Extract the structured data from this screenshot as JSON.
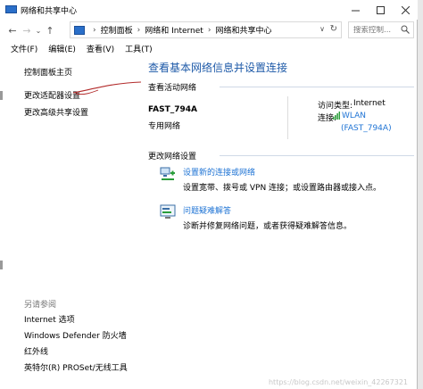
{
  "window": {
    "title": "网络和共享中心"
  },
  "nav": {
    "back_arrow": "←",
    "forward_arrow": "→",
    "recent_arrow": "⌄",
    "up_arrow": "↑",
    "breadcrumb": [
      "控制面板",
      "网络和 Internet",
      "网络和共享中心"
    ],
    "breadcrumb_sep": "›",
    "search_placeholder": "搜索控制..."
  },
  "menu": [
    "文件(F)",
    "编辑(E)",
    "查看(V)",
    "工具(T)"
  ],
  "sidebar": {
    "links": [
      "控制面板主页",
      "更改适配器设置",
      "更改高级共享设置"
    ],
    "see_also_title": "另请参阅",
    "see_also": [
      "Internet 选项",
      "Windows Defender 防火墙",
      "红外线",
      "英特尔(R) PROSet/无线工具"
    ]
  },
  "main": {
    "title": "查看基本网络信息并设置连接",
    "active_networks_head": "查看活动网络",
    "network_name": "FAST_794A",
    "network_type": "专用网络",
    "access_type_label": "访问类型:",
    "access_type_value": "Internet",
    "connection_label": "连接:",
    "connection_value": "WLAN",
    "connection_ssid": "(FAST_794A)",
    "change_settings_head": "更改网络设置",
    "tasks": [
      {
        "link": "设置新的连接或网络",
        "desc": "设置宽带、拨号或 VPN 连接；或设置路由器或接入点。"
      },
      {
        "link": "问题疑难解答",
        "desc": "诊断并修复网络问题，或者获得疑难解答信息。"
      }
    ]
  },
  "watermark": "https://blog.csdn.net/weixin_42267321"
}
